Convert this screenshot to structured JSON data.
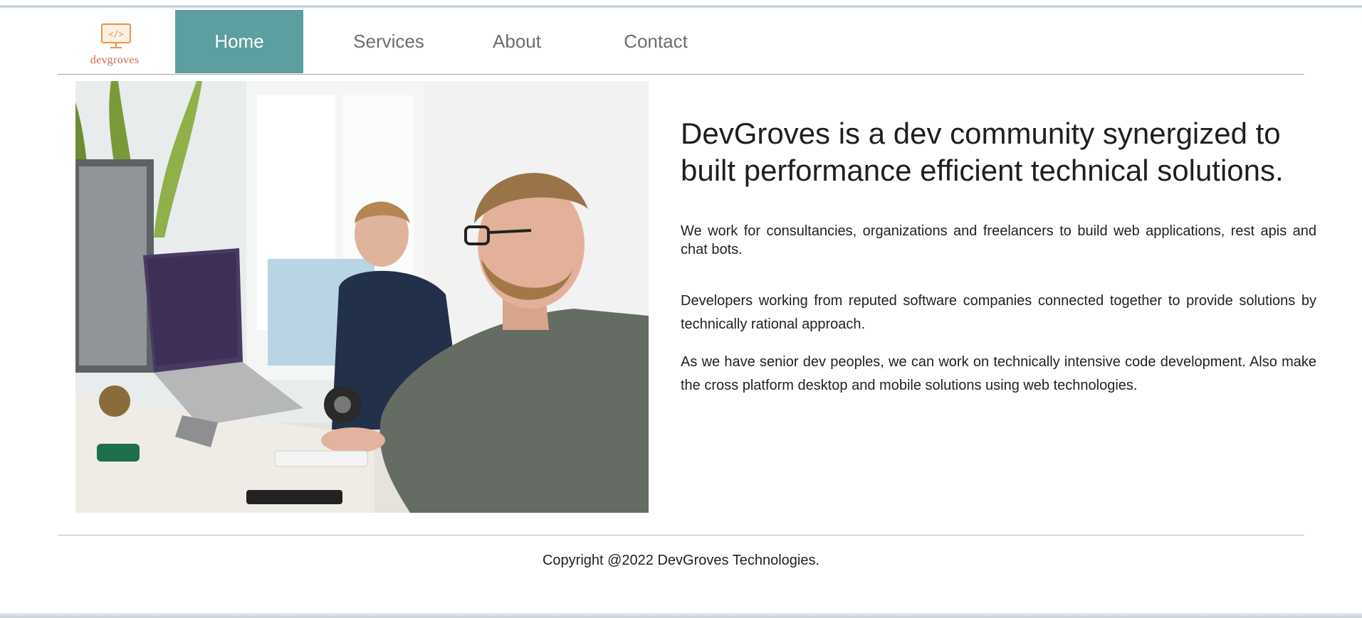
{
  "brand": {
    "name": "devgroves",
    "logo_glyph": "</>",
    "accent_color": "#5d9ea0",
    "logo_color": "#e8954f"
  },
  "nav": {
    "items": [
      {
        "label": "Home",
        "active": true
      },
      {
        "label": "Services",
        "active": false
      },
      {
        "label": "About",
        "active": false
      },
      {
        "label": "Contact",
        "active": false
      }
    ]
  },
  "hero": {
    "title": "DevGroves is a dev community synergized to built performance efficient technical solutions.",
    "paragraphs": [
      "We work for consultancies, organizations and freelancers to build web applications, rest apis and chat bots.",
      "Developers working from reputed software companies connected together to provide solutions by technically rational approach.",
      "As we have senior dev peoples, we can work on technically intensive code development. Also make the cross platform desktop and mobile solutions using web technologies."
    ]
  },
  "footer": {
    "copyright": "Copyright @2022 DevGroves Technologies."
  }
}
